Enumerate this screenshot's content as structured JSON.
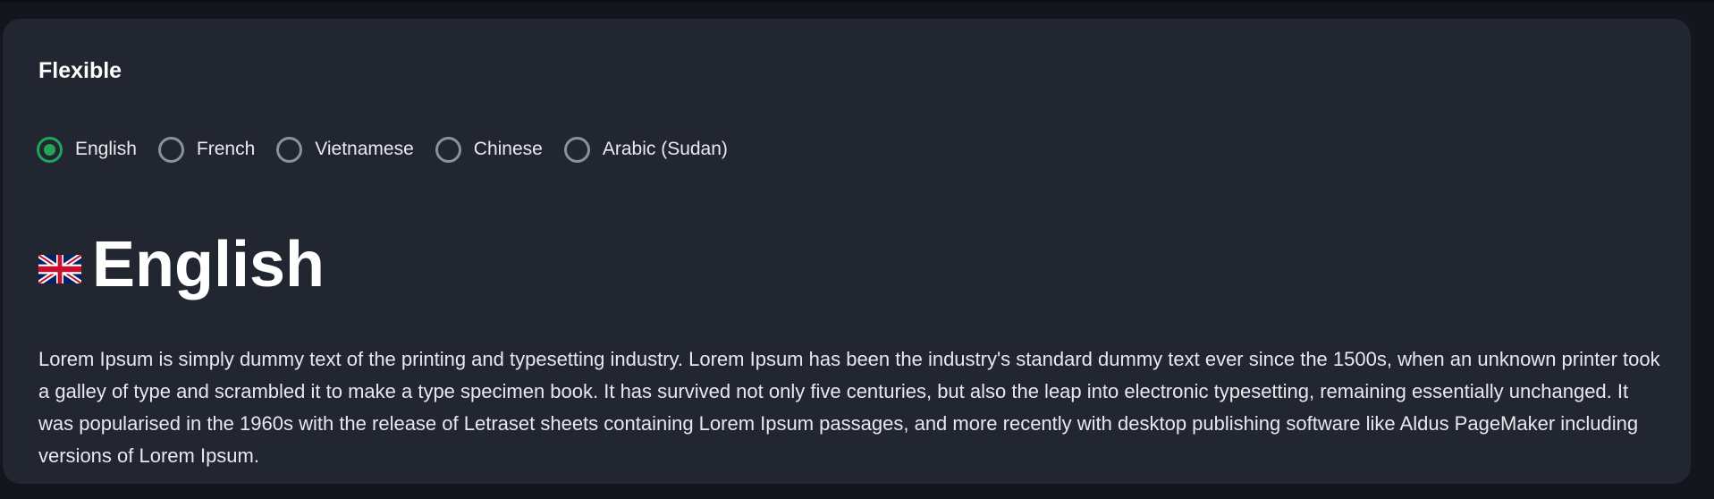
{
  "panel": {
    "title": "Flexible"
  },
  "languages": {
    "selected_index": 0,
    "options": [
      {
        "label": "English",
        "checked": true
      },
      {
        "label": "French",
        "checked": false
      },
      {
        "label": "Vietnamese",
        "checked": false
      },
      {
        "label": "Chinese",
        "checked": false
      },
      {
        "label": "Arabic (Sudan)",
        "checked": false
      }
    ]
  },
  "content": {
    "flag_icon": "uk-flag-icon",
    "heading": "English",
    "paragraph": "Lorem Ipsum is simply dummy text of the printing and typesetting industry. Lorem Ipsum has been the industry's standard dummy text ever since the 1500s, when an unknown printer took a galley of type and scrambled it to make a type specimen book. It has survived not only five centuries, but also the leap into electronic typesetting, remaining essentially unchanged. It was popularised in the 1960s with the release of Letraset sheets containing Lorem Ipsum passages, and more recently with desktop publishing software like Aldus PageMaker including versions of Lorem Ipsum."
  },
  "colors": {
    "background": "#13161c",
    "card": "#212631",
    "accent": "#22a559",
    "radio_border": "#8b919a",
    "text": "#ffffff"
  }
}
